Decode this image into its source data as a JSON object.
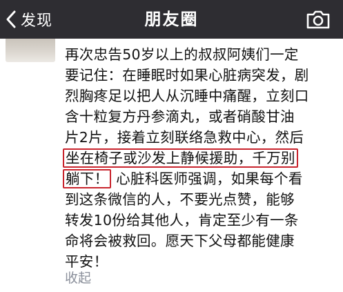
{
  "header": {
    "back_label": "发现",
    "title": "朋友圈",
    "icons": {
      "back": "chevron-left-icon",
      "camera": "camera-icon"
    }
  },
  "post": {
    "lines": [
      "再次忠告50岁以上的叔叔阿姨们一定",
      "要记住：在睡眠时如果心脏病突发，剧",
      "烈胸疼足以把人从沉睡中痛醒，立刻口",
      "含十粒复方丹参滴丸，或者硝酸甘油",
      "片2片，接着立刻联络急救中心，然后"
    ],
    "highlight_1": "坐在椅子或沙发上静候援助，千万别",
    "highlight_2": "躺下！",
    "line_after_highlight": "心脏科医师强调，如果每个看",
    "lines_end": [
      "到这条微信的人，不要光点赞，能够",
      "转发10份给其他人，肯定至少有一条",
      "命将会被救回。愿天下父母都能健康",
      "平安！"
    ],
    "collapse_label": "收起"
  },
  "colors": {
    "navbar": "#2e2d32",
    "highlight_border": "#c8232c",
    "link": "#8a8f9a"
  }
}
